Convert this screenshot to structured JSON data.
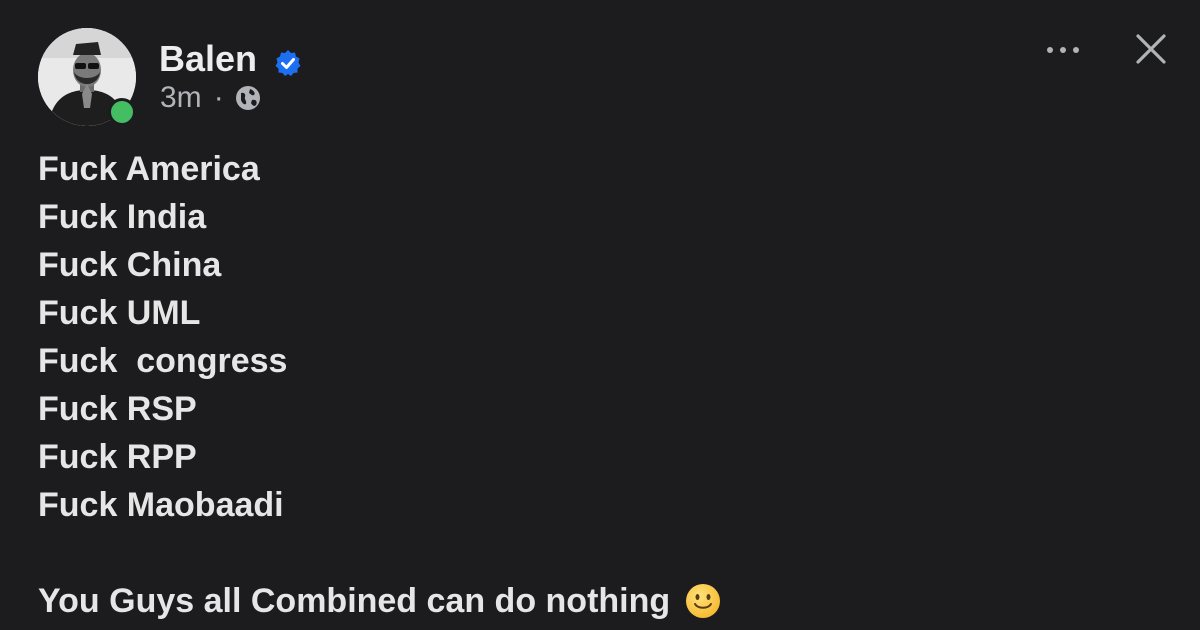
{
  "post": {
    "author": {
      "name": "Balen",
      "verified_icon": "verified-badge-icon",
      "online": true
    },
    "timestamp": "3m",
    "separator": "·",
    "privacy_icon": "globe-icon",
    "actions": {
      "more_icon": "more-options-icon",
      "close_icon": "close-icon"
    },
    "lines": [
      "Fuck America",
      "Fuck India",
      "Fuck China",
      "Fuck UML",
      "Fuck  congress",
      "Fuck RSP",
      "Fuck RPP",
      "Fuck Maobaadi"
    ],
    "closing_line": "You Guys all Combined can do nothing",
    "closing_emoji": "slightly-smiling-face-icon"
  },
  "colors": {
    "background": "#1c1c1e",
    "text": "#e6e6e6",
    "secondary_text": "#b0b3b8",
    "verified_blue": "#1d6ff2",
    "online_green": "#45bd62"
  }
}
